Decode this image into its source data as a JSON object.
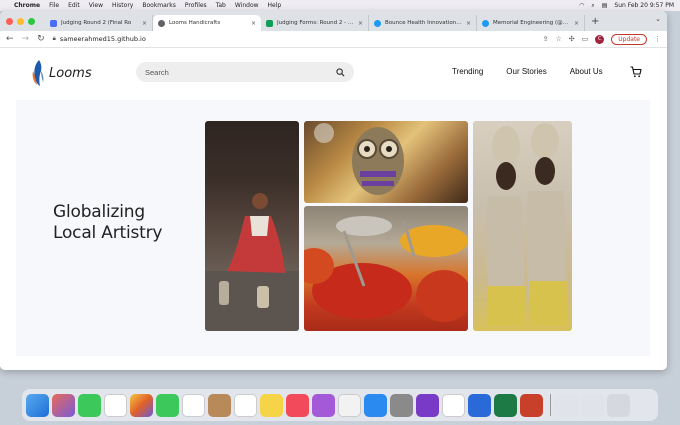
{
  "menubar": {
    "app": "Chrome",
    "items": [
      "File",
      "Edit",
      "View",
      "History",
      "Bookmarks",
      "Profiles",
      "Tab",
      "Window",
      "Help"
    ],
    "clock": "Sun Feb 20  9:57 PM"
  },
  "browser": {
    "tabs": [
      {
        "label": "Judging Round 2 (Final Ro",
        "favicon_color": "#4a6cf7",
        "active": false
      },
      {
        "label": "Looms Handicrafts",
        "favicon_color": "#5f6368",
        "active": true
      },
      {
        "label": "Judging Forms: Round 2 - Goo",
        "favicon_color": "#0f9d58",
        "active": false
      },
      {
        "label": "Bounce Health Innovation (@Bo",
        "favicon_color": "#1d9bf0",
        "active": false
      },
      {
        "label": "Memorial Engineering (@MUH",
        "favicon_color": "#1d9bf0",
        "active": false
      }
    ],
    "url": "sameerahmed15.github.io",
    "profile_initial": "C",
    "update_label": "Update"
  },
  "site": {
    "logo_text": "Looms",
    "search": {
      "placeholder": "Search",
      "value": ""
    },
    "nav": [
      "Trending",
      "Our Stories",
      "About Us"
    ],
    "hero": {
      "title_line1": "Globalizing",
      "title_line2": "Local Artistry"
    }
  },
  "colors": {
    "accent_blue": "#1e5aa8",
    "update_red": "#c0392b",
    "hero_bg": "#f6f8fb"
  }
}
